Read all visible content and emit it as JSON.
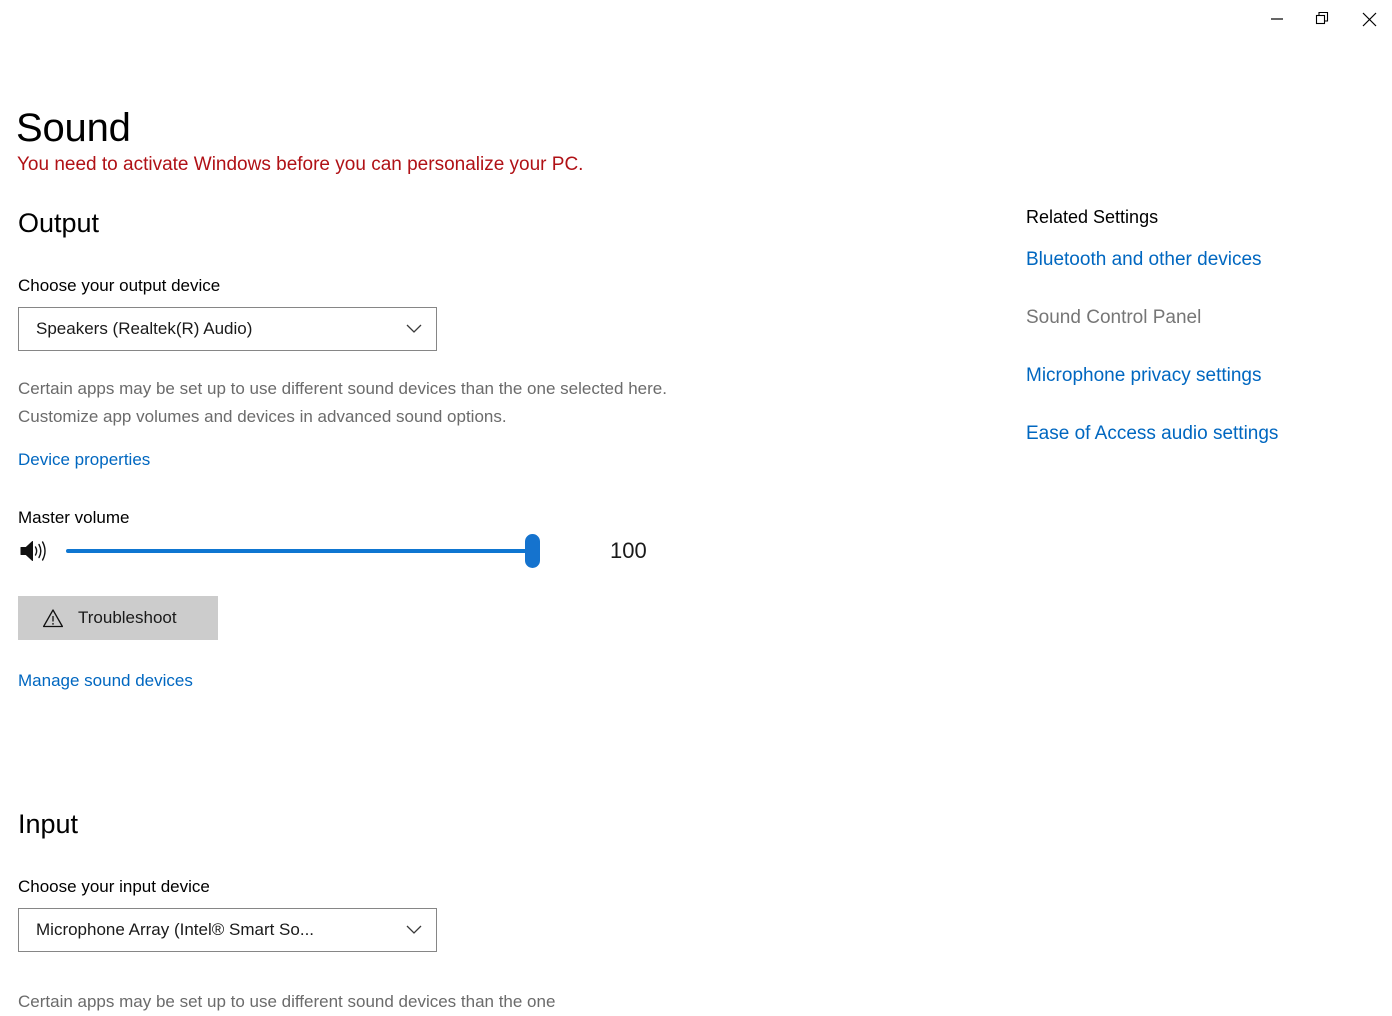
{
  "window": {
    "controls": [
      {
        "name": "minimize",
        "label": "Minimize"
      },
      {
        "name": "restore",
        "label": "Restore Down"
      },
      {
        "name": "close",
        "label": "Close"
      }
    ]
  },
  "page": {
    "title": "Sound",
    "activation_warning": "You need to activate Windows before you can personalize your PC."
  },
  "output": {
    "heading": "Output",
    "device_label": "Choose your output device",
    "device_value": "Speakers (Realtek(R) Audio)",
    "help_text": "Certain apps may be set up to use different sound devices than the one selected here. Customize app volumes and devices in advanced sound options.",
    "device_properties_link": "Device properties",
    "volume_label": "Master volume",
    "volume_value": "100",
    "volume_percent": 100,
    "troubleshoot_label": "Troubleshoot",
    "manage_devices_link": "Manage sound devices"
  },
  "input": {
    "heading": "Input",
    "device_label": "Choose your input device",
    "device_value": "Microphone Array (Intel® Smart So...",
    "help_text": "Certain apps may be set up to use different sound devices than the one"
  },
  "related_settings": {
    "heading": "Related Settings",
    "links": [
      {
        "label": "Bluetooth and other devices",
        "disabled": false
      },
      {
        "label": "Sound Control Panel",
        "disabled": true
      },
      {
        "label": "Microphone privacy settings",
        "disabled": false
      },
      {
        "label": "Ease of Access audio settings",
        "disabled": false
      }
    ]
  },
  "colors": {
    "link": "#0067c0",
    "warning_red": "#b01116",
    "slider_blue": "#0f76d1",
    "button_gray": "#cccccc",
    "muted_text": "#6b6b6b"
  }
}
